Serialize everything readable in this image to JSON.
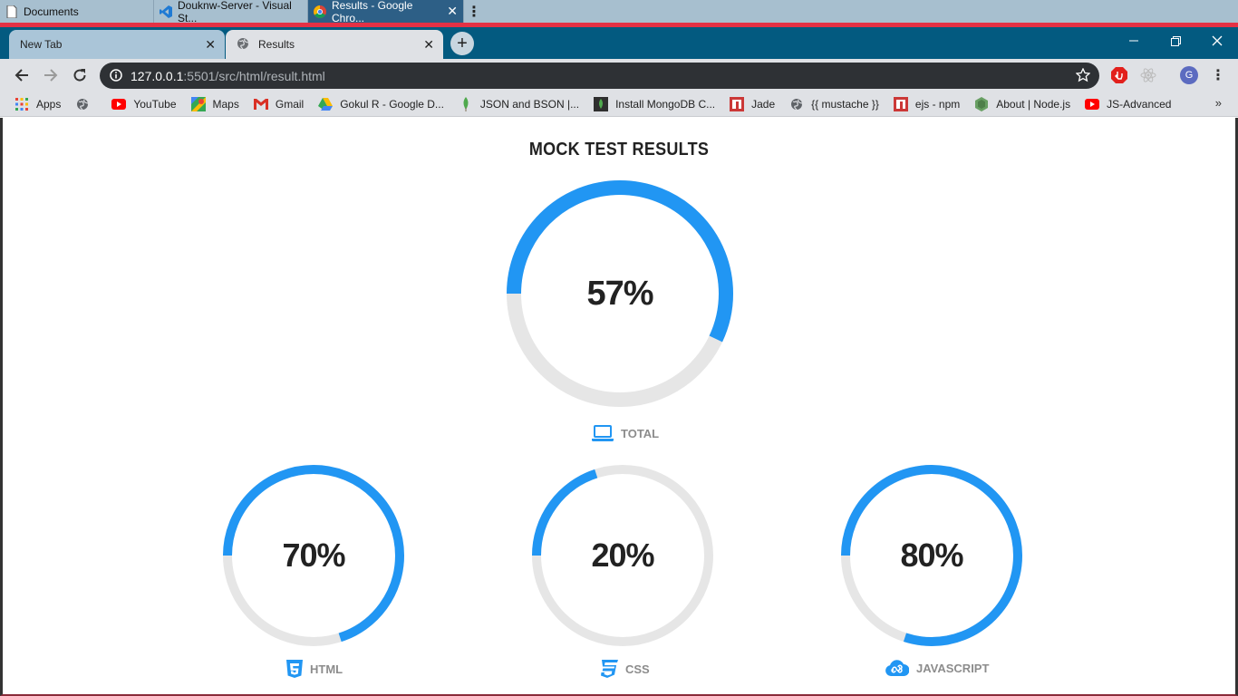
{
  "taskbar": {
    "windows": [
      {
        "label": "Documents",
        "icon": "document-icon"
      },
      {
        "label": "Douknw-Server - Visual St...",
        "icon": "vscode-icon"
      },
      {
        "label": "Results - Google Chro...",
        "icon": "chrome-icon",
        "active": true
      }
    ]
  },
  "browser": {
    "tabs": [
      {
        "label": "New Tab"
      },
      {
        "label": "Results"
      }
    ],
    "url_host": "127.0.0.1",
    "url_path": ":5501/src/html/result.html",
    "profile_initial": "G",
    "bookmarks": [
      {
        "label": "Apps",
        "icon": "apps-grid-icon"
      },
      {
        "label": "",
        "icon": "globe-icon"
      },
      {
        "label": "YouTube",
        "icon": "youtube-icon"
      },
      {
        "label": "Maps",
        "icon": "maps-icon"
      },
      {
        "label": "Gmail",
        "icon": "gmail-icon"
      },
      {
        "label": "Gokul R - Google D...",
        "icon": "drive-icon"
      },
      {
        "label": "JSON and BSON |...",
        "icon": "mongodb-leaf-icon"
      },
      {
        "label": "Install MongoDB C...",
        "icon": "mongodb-icon"
      },
      {
        "label": "Jade",
        "icon": "npm-icon"
      },
      {
        "label": "{{ mustache }}",
        "icon": "globe-icon"
      },
      {
        "label": "ejs - npm",
        "icon": "npm-icon"
      },
      {
        "label": "About | Node.js",
        "icon": "nodejs-icon"
      },
      {
        "label": "JS-Advanced",
        "icon": "youtube-icon"
      }
    ]
  },
  "page": {
    "title": "MOCK TEST RESULTS",
    "total": {
      "label": "TOTAL",
      "percent_text": "57%",
      "value": 0.57,
      "icon": "laptop-icon"
    },
    "subjects": [
      {
        "label": "HTML",
        "percent_text": "70%",
        "value": 0.7,
        "icon": "html5-icon"
      },
      {
        "label": "CSS",
        "percent_text": "20%",
        "value": 0.2,
        "icon": "css3-icon"
      },
      {
        "label": "JAVASCRIPT",
        "percent_text": "80%",
        "value": 0.8,
        "icon": "cloud-link-icon"
      }
    ]
  },
  "colors": {
    "accent": "#2196f3",
    "track": "#e6e6e6",
    "text": "#222222",
    "label": "#8c8c8c"
  }
}
